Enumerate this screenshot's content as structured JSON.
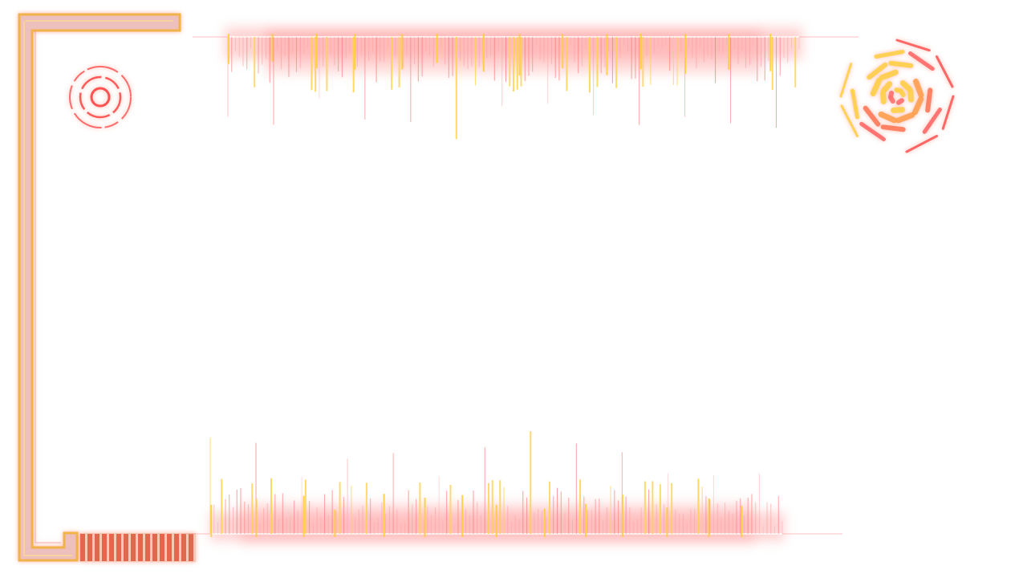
{
  "overlay": {
    "kind": "neon HUD frame overlay",
    "text_content": []
  },
  "colors": {
    "background": "#ffffff",
    "neon_red": "#ff5a5a",
    "neon_orange": "#ff9a4a",
    "neon_amber": "#ffb347",
    "neon_yellow": "#ffe36a",
    "bracket_fill": "#e9a3a0",
    "bracket_edge": "#f0b24c",
    "stripe_block": "#e2674c"
  },
  "icons": {
    "top_left": "concentric-rings-icon",
    "top_right": "radial-octagon-burst-icon",
    "bottom_left": "striped-block-icon"
  }
}
